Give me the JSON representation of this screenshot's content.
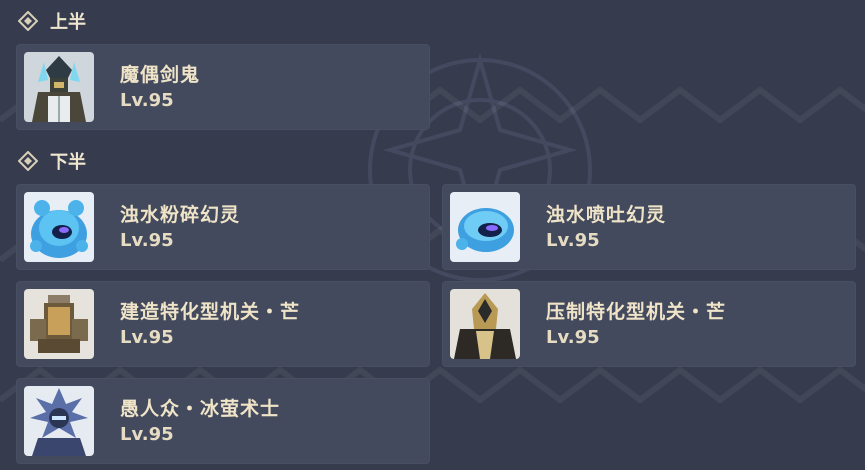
{
  "sections": [
    {
      "title": "上半",
      "enemies": [
        {
          "name": "魔偶剑鬼",
          "level": "Lv.95",
          "icon": "puppet-swordsman-icon"
        }
      ]
    },
    {
      "title": "下半",
      "enemies": [
        {
          "name": "浊水粉碎幻灵",
          "level": "Lv.95",
          "icon": "mirror-maiden-shatter-slime-icon"
        },
        {
          "name": "浊水喷吐幻灵",
          "level": "Lv.95",
          "icon": "water-spit-phantasm-icon"
        },
        {
          "name": "建造特化型机关・芒",
          "level": "Lv.95",
          "icon": "construction-mech-icon"
        },
        {
          "name": "压制特化型机关・芒",
          "level": "Lv.95",
          "icon": "suppression-mech-icon"
        },
        {
          "name": "愚人众・冰萤术士",
          "level": "Lv.95",
          "icon": "fatui-cryo-cicin-mage-icon"
        }
      ]
    }
  ],
  "colors": {
    "background": "#363b4d",
    "card": "#444a5d",
    "text": "#efe4c8"
  }
}
